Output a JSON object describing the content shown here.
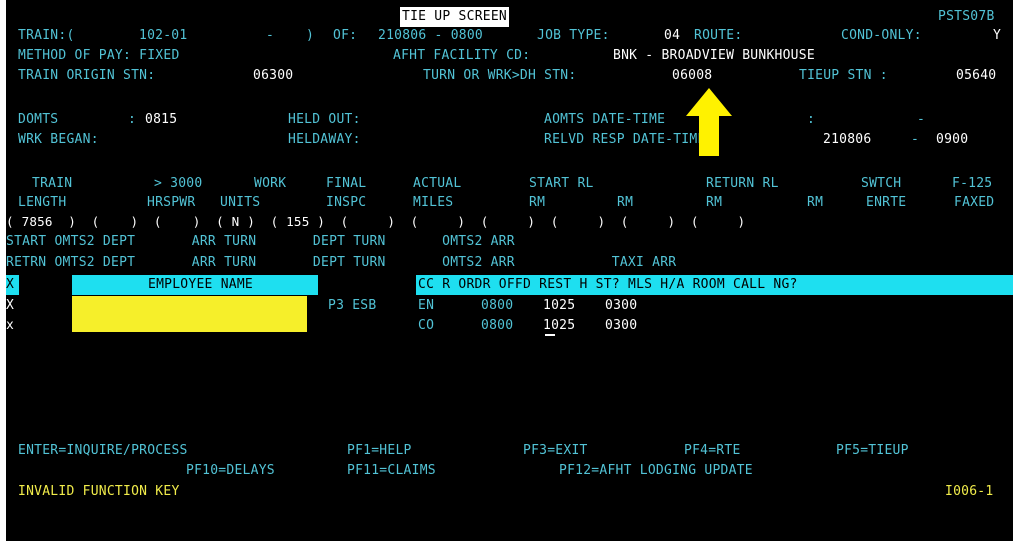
{
  "header": {
    "title": "TIE UP SCREEN",
    "program_id": "PSTS07B",
    "train_label": "TRAIN:(",
    "train_id": "102-01",
    "train_dash": "-",
    "train_close": ")",
    "of_label": "OF:",
    "of_value": "210806 - 0800",
    "job_type_label": "JOB TYPE:",
    "job_type_value": "04",
    "route_label": "ROUTE:",
    "cond_only_label": "COND-ONLY:",
    "cond_only_value": "Y",
    "method_pay": "METHOD OF PAY: FIXED",
    "afht_label": "AFHT FACILITY CD:",
    "afht_value": "BNK - BROADVIEW BUNKHOUSE",
    "origin_label": "TRAIN ORIGIN STN:",
    "origin_value": "06300",
    "turn_label": "TURN OR WRK>DH STN:",
    "turn_value": "06008",
    "tieup_label": "TIEUP STN :",
    "tieup_value": "05640"
  },
  "times": {
    "domts_label": "DOMTS",
    "domts_sep": ":",
    "domts_value": "0815",
    "held_out_label": "HELD OUT:",
    "aomts_label": "AOMTS DATE-TIME",
    "aomts_sep": ":",
    "aomts_dash": "-",
    "wrk_began_label": "WRK BEGAN:",
    "heldaway_label": "HELDAWAY:",
    "relvd_label": "RELVD RESP DATE-TIME:",
    "relvd_value": "210806",
    "relvd_dash": "-",
    "relvd_time": "0900"
  },
  "train_table": {
    "head1": [
      "TRAIN",
      "> 3000",
      "WORK",
      "FINAL",
      "ACTUAL",
      "START RL",
      "RETURN RL",
      "SWTCH",
      "F-125"
    ],
    "head2": [
      "LENGTH",
      "HRSPWR",
      "UNITS",
      "INSPC",
      "MILES",
      "RM",
      "RM",
      "RM",
      "RM",
      "ENRTE",
      "FAXED"
    ],
    "row_text": "( 7856  )  (    )  (    )  ( N )  ( 155 )  (     )  (     )  (     )  (     )  (     )  (     )"
  },
  "omts": {
    "start_line": "START OMTS2 DEPT       ARR TURN       DEPT TURN       OMTS2 ARR",
    "retrn_line": "RETRN OMTS2 DEPT       ARR TURN       DEPT TURN       OMTS2 ARR            TAXI ARR"
  },
  "crew": {
    "header_mark": "X",
    "name_header": "EMPLOYEE NAME",
    "columns": "CC R ORDR OFFD REST H ST? MLS H/A ROOM CALL NG?",
    "rows": [
      {
        "mark": "X",
        "extra": "P3 ESB",
        "cc": "EN",
        "ordr": "0800",
        "offd": "1025",
        "rest": "0300"
      },
      {
        "mark": "x",
        "extra": "",
        "cc": "CO",
        "ordr": "0800",
        "offd": "1025",
        "rest": "0300"
      }
    ]
  },
  "footer": {
    "keys1": [
      {
        "label": "ENTER=INQUIRE/PROCESS"
      },
      {
        "label": "PF1=HELP"
      },
      {
        "label": "PF3=EXIT"
      },
      {
        "label": "PF4=RTE"
      },
      {
        "label": "PF5=TIEUP"
      }
    ],
    "keys2": [
      {
        "label": "PF10=DELAYS"
      },
      {
        "label": "PF11=CLAIMS"
      },
      {
        "label": "PF12=AFHT LODGING UPDATE"
      }
    ],
    "message": "INVALID FUNCTION KEY",
    "message_code": "I006-1"
  },
  "colors": {
    "label": "#52c3d6",
    "value": "#ffffff",
    "highlight_bar": "#1edff0",
    "redaction": "#f6ef2a",
    "arrow": "#fff200"
  }
}
